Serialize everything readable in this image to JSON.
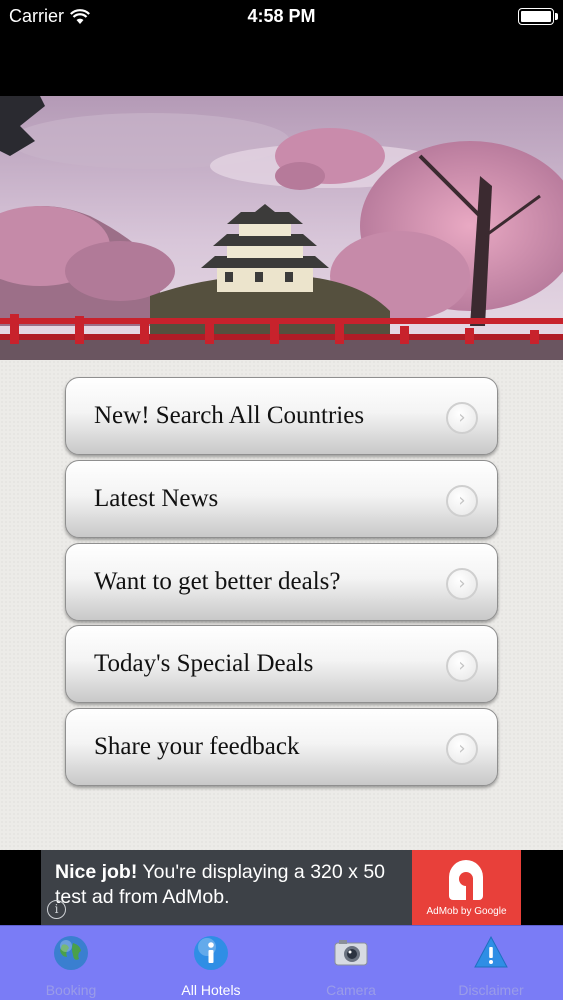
{
  "status_bar": {
    "carrier": "Carrier",
    "time": "4:58 PM"
  },
  "hero": {
    "icon": "japanese-castle-cherry-blossom-photo"
  },
  "menu": {
    "items": [
      {
        "label": "New! Search All Countries",
        "icon": "chevron-right-icon"
      },
      {
        "label": "Latest News",
        "icon": "chevron-right-icon"
      },
      {
        "label": "Want to get better deals?",
        "icon": "chevron-right-icon"
      },
      {
        "label": "Today's Special Deals",
        "icon": "chevron-right-icon"
      },
      {
        "label": "Share your feedback",
        "icon": "chevron-right-icon"
      }
    ]
  },
  "ad": {
    "headline": "Nice job!",
    "body": " You're displaying a 320 x 50 test ad from AdMob.",
    "logo_caption": "AdMob by Google",
    "colors": {
      "background": "#3d4147",
      "logo": "#e8403a"
    }
  },
  "tab_bar": {
    "active_index": 1,
    "tabs": [
      {
        "label": "Booking",
        "icon": "globe-icon"
      },
      {
        "label": "All Hotels",
        "icon": "info-icon"
      },
      {
        "label": "Camera",
        "icon": "camera-icon"
      },
      {
        "label": "Disclaimer",
        "icon": "warning-icon"
      }
    ],
    "colors": {
      "background": "#7a7cf6",
      "active_label": "#ffffff"
    }
  }
}
